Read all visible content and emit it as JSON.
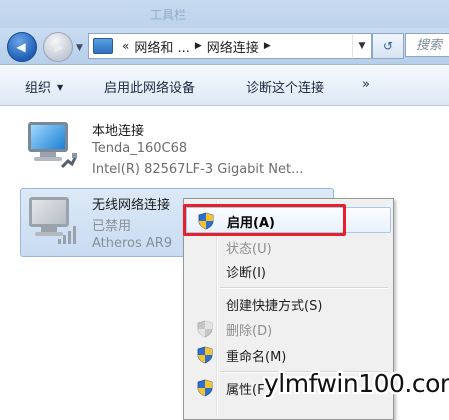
{
  "window": {
    "faint_title": "工具栏"
  },
  "navigation": {
    "back_glyph": "◀",
    "forward_glyph": "▶",
    "address": {
      "crumb_prefix": "«",
      "crumbs": [
        "网络和 ...",
        "网络连接"
      ],
      "separator": "▶",
      "dropdown_glyph": "▼"
    },
    "refresh_glyph": "↺",
    "search_placeholder": "搜索"
  },
  "toolbar": {
    "organize": "组织",
    "enable_device": "启用此网络设备",
    "diagnose": "诊断这个连接",
    "more": "»"
  },
  "connections": [
    {
      "name": "本地连接",
      "status": "Tenda_160C68",
      "adapter": "Intel(R) 82567LF-3 Gigabit Net...",
      "icon": "wired-network-icon",
      "state": "connected"
    },
    {
      "name": "无线网络连接",
      "status": "已禁用",
      "adapter": "Atheros AR9",
      "icon": "wireless-network-icon",
      "state": "disabled"
    }
  ],
  "context_menu": {
    "items": [
      {
        "label": "启用(A)",
        "shield": true,
        "enabled": true,
        "highlighted": true
      },
      {
        "label": "状态(U)",
        "shield": false,
        "enabled": false
      },
      {
        "label": "诊断(I)",
        "shield": false,
        "enabled": true
      },
      {
        "label": "创建快捷方式(S)",
        "shield": false,
        "enabled": true
      },
      {
        "label": "删除(D)",
        "shield": true,
        "enabled": false
      },
      {
        "label": "重命名(M)",
        "shield": true,
        "enabled": true
      },
      {
        "label": "属性(R)",
        "shield": true,
        "enabled": true
      }
    ],
    "visible_partial_label": "属性(F"
  },
  "annotation": {
    "highlight_color": "#e8202a"
  },
  "watermark": {
    "text": "ylmfwin100.com"
  },
  "colors": {
    "chrome": "#c7daf0",
    "selection": "#c9dcf2",
    "menu_background": "#f0f0f0"
  }
}
